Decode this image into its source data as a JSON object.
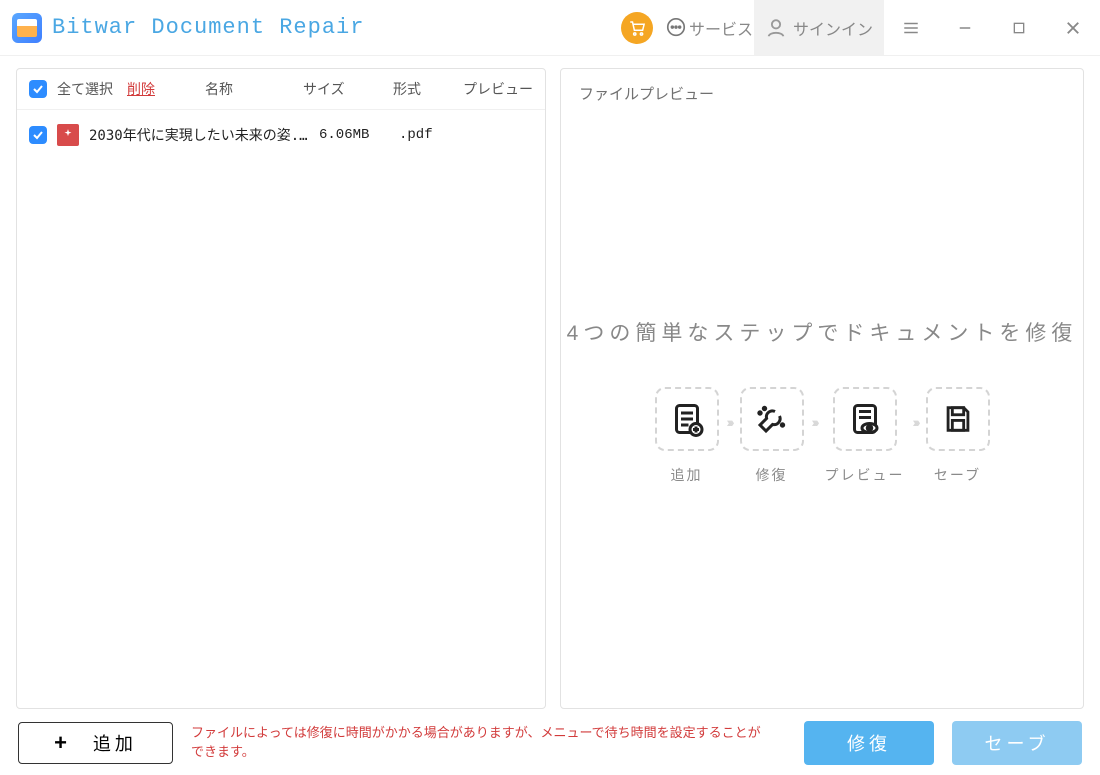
{
  "app": {
    "title": "Bitwar Document Repair"
  },
  "titlebar": {
    "service_label": "サービス",
    "signin_label": "サインイン"
  },
  "list": {
    "select_all_label": "全て選択",
    "delete_label": "削除",
    "col_name": "名称",
    "col_size": "サイズ",
    "col_format": "形式",
    "col_preview": "プレビュー",
    "files": [
      {
        "checked": true,
        "name": "2030年代に実現したい未来の姿...",
        "size": "6.06MB",
        "format": ".pdf"
      }
    ]
  },
  "preview": {
    "title": "ファイルプレビュー",
    "heading": "4つの簡単なステップでドキュメントを修復",
    "steps": [
      {
        "label": "追加",
        "icon": "document-add"
      },
      {
        "label": "修復",
        "icon": "repair-tool"
      },
      {
        "label": "プレビュー",
        "icon": "eye-doc"
      },
      {
        "label": "セーブ",
        "icon": "save-disk"
      }
    ]
  },
  "footer": {
    "add_label": "追加",
    "note": "ファイルによっては修復に時間がかかる場合がありますが、メニューで待ち時間を設定することができます。",
    "repair_label": "修復",
    "save_label": "セーブ"
  }
}
